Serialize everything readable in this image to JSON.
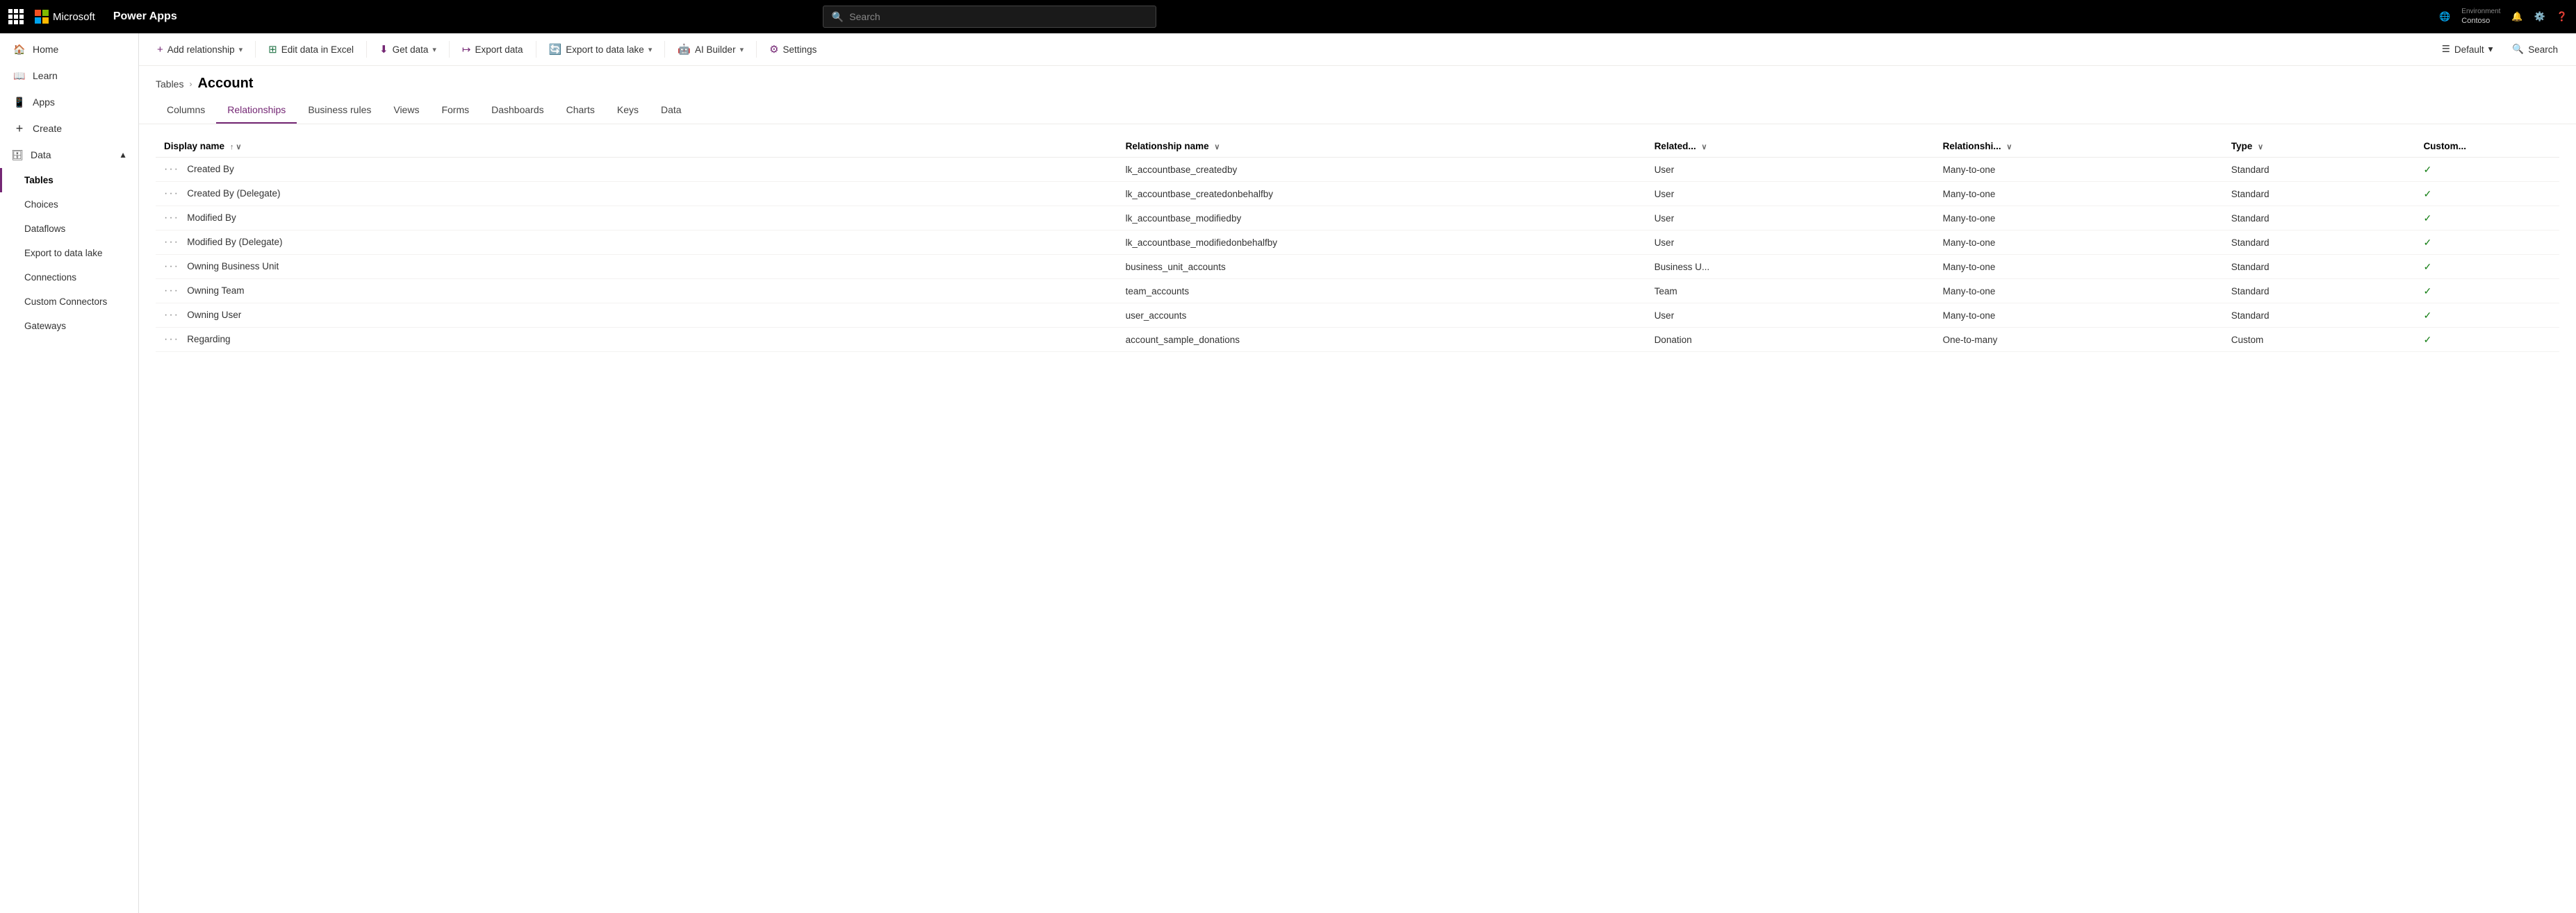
{
  "topNav": {
    "appName": "Power Apps",
    "msLabel": "Microsoft",
    "searchPlaceholder": "Search",
    "envLabel": "Environment",
    "envName": "Contoso"
  },
  "sidebar": {
    "items": [
      {
        "id": "home",
        "label": "Home",
        "icon": "🏠"
      },
      {
        "id": "learn",
        "label": "Learn",
        "icon": "📖"
      },
      {
        "id": "apps",
        "label": "Apps",
        "icon": "📱"
      },
      {
        "id": "create",
        "label": "Create",
        "icon": "+"
      },
      {
        "id": "data",
        "label": "Data",
        "icon": "🗄",
        "expanded": true
      },
      {
        "id": "tables",
        "label": "Tables",
        "sub": true,
        "active": true
      },
      {
        "id": "choices",
        "label": "Choices",
        "sub": true
      },
      {
        "id": "dataflows",
        "label": "Dataflows",
        "sub": true
      },
      {
        "id": "export",
        "label": "Export to data lake",
        "sub": true
      },
      {
        "id": "connections",
        "label": "Connections",
        "sub": true
      },
      {
        "id": "customconnectors",
        "label": "Custom Connectors",
        "sub": true
      },
      {
        "id": "gateways",
        "label": "Gateways",
        "sub": true
      }
    ]
  },
  "toolbar": {
    "addRelationship": "Add relationship",
    "editDataInExcel": "Edit data in Excel",
    "getData": "Get data",
    "exportData": "Export data",
    "exportToDataLake": "Export to data lake",
    "aiBuilder": "AI Builder",
    "settings": "Settings",
    "default": "Default",
    "search": "Search"
  },
  "breadcrumb": {
    "parent": "Tables",
    "current": "Account"
  },
  "tabs": [
    {
      "id": "columns",
      "label": "Columns"
    },
    {
      "id": "relationships",
      "label": "Relationships",
      "active": true
    },
    {
      "id": "businessrules",
      "label": "Business rules"
    },
    {
      "id": "views",
      "label": "Views"
    },
    {
      "id": "forms",
      "label": "Forms"
    },
    {
      "id": "dashboards",
      "label": "Dashboards"
    },
    {
      "id": "charts",
      "label": "Charts"
    },
    {
      "id": "keys",
      "label": "Keys"
    },
    {
      "id": "data",
      "label": "Data"
    }
  ],
  "table": {
    "columns": [
      {
        "id": "displayname",
        "label": "Display name",
        "sortable": true,
        "sortDir": "asc"
      },
      {
        "id": "relname",
        "label": "Relationship name",
        "sortable": true
      },
      {
        "id": "related",
        "label": "Related...",
        "sortable": true
      },
      {
        "id": "reltype",
        "label": "Relationshi...",
        "sortable": true
      },
      {
        "id": "type",
        "label": "Type",
        "sortable": true
      },
      {
        "id": "custom",
        "label": "Custom..."
      }
    ],
    "rows": [
      {
        "displayName": "Created By",
        "relName": "lk_accountbase_createdby",
        "related": "User",
        "relType": "Many-to-one",
        "type": "Standard",
        "custom": true
      },
      {
        "displayName": "Created By (Delegate)",
        "relName": "lk_accountbase_createdonbehalfby",
        "related": "User",
        "relType": "Many-to-one",
        "type": "Standard",
        "custom": true
      },
      {
        "displayName": "Modified By",
        "relName": "lk_accountbase_modifiedby",
        "related": "User",
        "relType": "Many-to-one",
        "type": "Standard",
        "custom": true
      },
      {
        "displayName": "Modified By (Delegate)",
        "relName": "lk_accountbase_modifiedonbehalfby",
        "related": "User",
        "relType": "Many-to-one",
        "type": "Standard",
        "custom": true
      },
      {
        "displayName": "Owning Business Unit",
        "relName": "business_unit_accounts",
        "related": "Business U...",
        "relType": "Many-to-one",
        "type": "Standard",
        "custom": true
      },
      {
        "displayName": "Owning Team",
        "relName": "team_accounts",
        "related": "Team",
        "relType": "Many-to-one",
        "type": "Standard",
        "custom": true
      },
      {
        "displayName": "Owning User",
        "relName": "user_accounts",
        "related": "User",
        "relType": "Many-to-one",
        "type": "Standard",
        "custom": true
      },
      {
        "displayName": "Regarding",
        "relName": "account_sample_donations",
        "related": "Donation",
        "relType": "One-to-many",
        "type": "Custom",
        "custom": true
      }
    ]
  }
}
